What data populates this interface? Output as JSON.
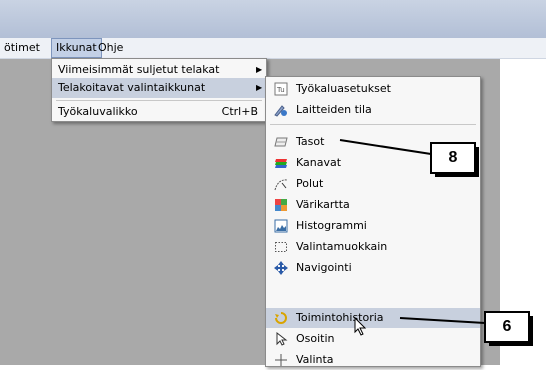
{
  "menubar": {
    "items": [
      {
        "label": "ötimet"
      },
      {
        "label": "Ikkunat"
      },
      {
        "label": "Ohje"
      }
    ]
  },
  "window_menu": {
    "items": [
      {
        "label": "Viimeisimmät suljetut telakat",
        "submenu": true
      },
      {
        "label": "Telakoitavat valintaikkunat",
        "submenu": true
      },
      {
        "label": "Työkaluvalikko",
        "shortcut": "Ctrl+B"
      }
    ]
  },
  "dock_submenu": {
    "items": [
      {
        "label": "Työkaluasetukset",
        "icon": "tool-options-icon"
      },
      {
        "label": "Laitteiden tila",
        "icon": "device-status-icon"
      },
      {
        "label": "Tasot",
        "icon": "layers-icon"
      },
      {
        "label": "Kanavat",
        "icon": "channels-icon"
      },
      {
        "label": "Polut",
        "icon": "paths-icon"
      },
      {
        "label": "Värikartta",
        "icon": "colormap-icon"
      },
      {
        "label": "Histogrammi",
        "icon": "histogram-icon"
      },
      {
        "label": "Valintamuokkain",
        "icon": "selection-editor-icon"
      },
      {
        "label": "Navigointi",
        "icon": "navigation-icon"
      },
      {
        "label": "Toimintohistoria",
        "icon": "undo-history-icon"
      },
      {
        "label": "Osoitin",
        "icon": "pointer-icon"
      },
      {
        "label": "Valinta",
        "icon": "selection-icon"
      }
    ]
  },
  "callouts": [
    {
      "label": "8"
    },
    {
      "label": "6"
    }
  ],
  "colors": {
    "highlight": "#c8d0de",
    "workspace": "#a9a9a9",
    "titlebar": "#b2bfd6"
  }
}
